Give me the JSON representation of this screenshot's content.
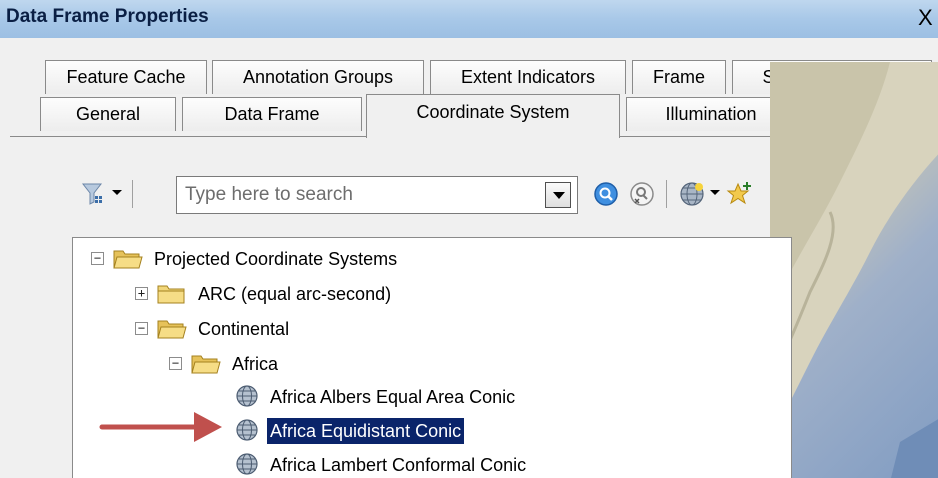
{
  "window": {
    "title": "Data Frame Properties",
    "close_glyph": "X"
  },
  "tabs": {
    "row1": [
      "Feature Cache",
      "Annotation Groups",
      "Extent Indicators",
      "Frame",
      "Size and Position"
    ],
    "row2": [
      "General",
      "Data Frame",
      "Coordinate System",
      "Illumination"
    ],
    "selected": "Coordinate System"
  },
  "toolbar": {
    "search": {
      "placeholder": "Type here to search"
    },
    "icons": [
      "filter-icon",
      "search-icon",
      "clear-search-icon",
      "globe-icon",
      "add-favorite-icon"
    ]
  },
  "tree": {
    "items": [
      {
        "label": "Projected Coordinate Systems",
        "expander": "−",
        "type": "folder-open",
        "level": 0
      },
      {
        "label": "ARC (equal arc-second)",
        "expander": "+",
        "type": "folder-closed",
        "level": 1
      },
      {
        "label": "Continental",
        "expander": "−",
        "type": "folder-open",
        "level": 1
      },
      {
        "label": "Africa",
        "expander": "−",
        "type": "folder-open",
        "level": 2
      },
      {
        "label": "Africa Albers Equal Area Conic",
        "type": "globe",
        "level": 3
      },
      {
        "label": "Africa Equidistant Conic",
        "type": "globe",
        "level": 3,
        "selected": true
      },
      {
        "label": "Africa Lambert Conformal Conic",
        "type": "globe",
        "level": 3
      }
    ]
  },
  "colors": {
    "selection": "#0a246a",
    "arrow": "#c0504d",
    "title_bar": "#a8c8e8"
  }
}
